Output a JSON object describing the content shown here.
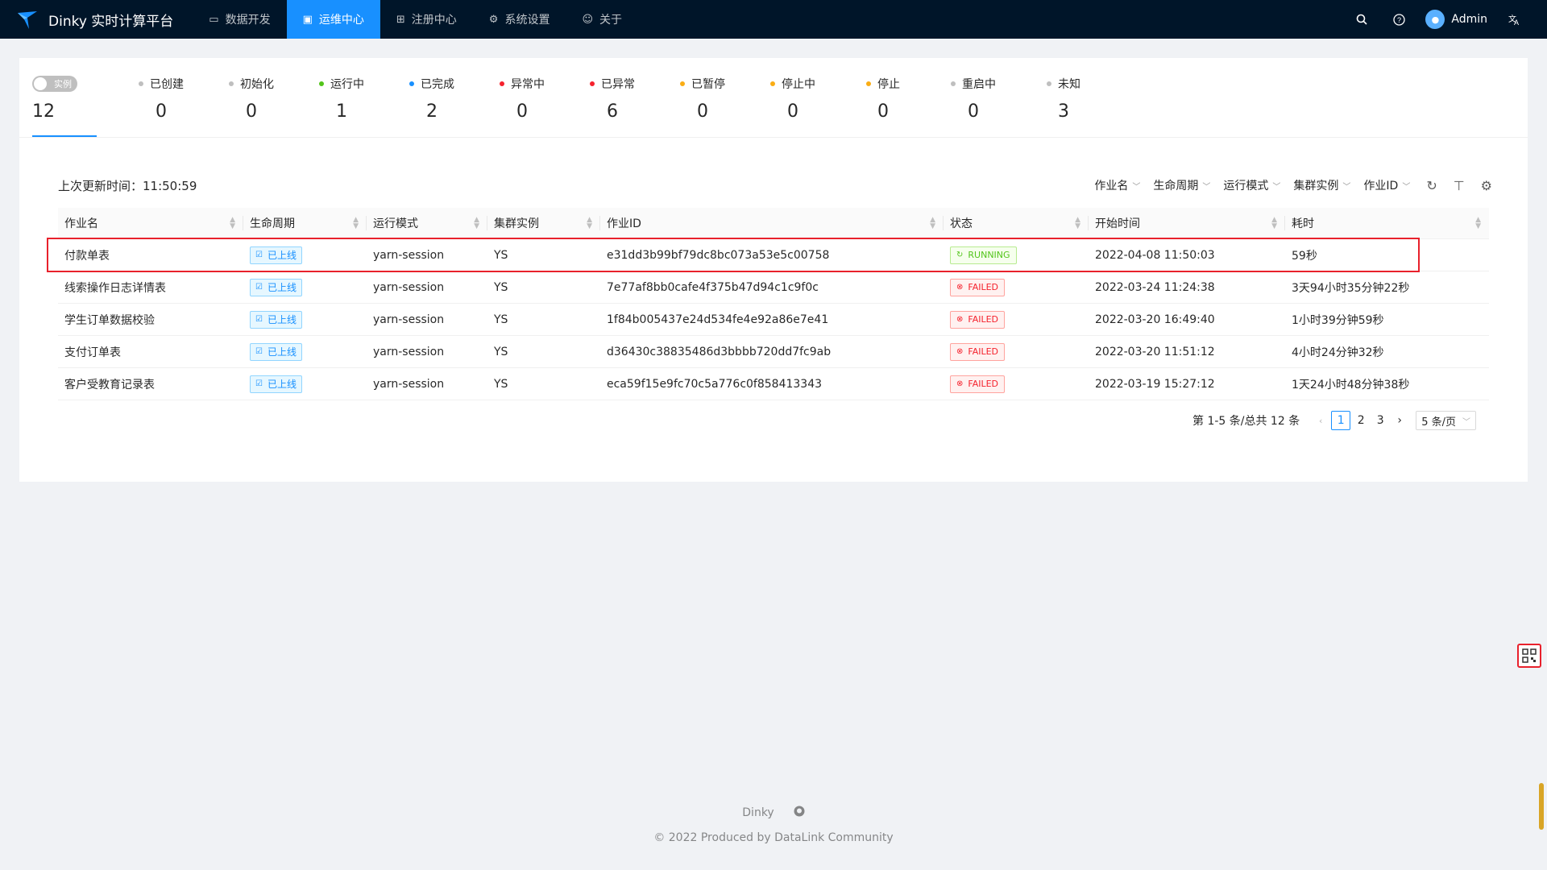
{
  "app": {
    "title": "Dinky 实时计算平台"
  },
  "nav": [
    {
      "label": "数据开发",
      "icon": "monitor-icon"
    },
    {
      "label": "运维中心",
      "icon": "dashboard-icon",
      "active": true
    },
    {
      "label": "注册中心",
      "icon": "appstore-icon"
    },
    {
      "label": "系统设置",
      "icon": "gear-icon"
    },
    {
      "label": "关于",
      "icon": "check-circle-icon"
    }
  ],
  "user": {
    "name": "Admin"
  },
  "stats": {
    "switch_label": "实例",
    "total": "12",
    "items": [
      {
        "label": "已创建",
        "value": "0",
        "color": "#bfbfbf"
      },
      {
        "label": "初始化",
        "value": "0",
        "color": "#bfbfbf"
      },
      {
        "label": "运行中",
        "value": "1",
        "color": "#52c41a"
      },
      {
        "label": "已完成",
        "value": "2",
        "color": "#1890ff"
      },
      {
        "label": "异常中",
        "value": "0",
        "color": "#f5222d"
      },
      {
        "label": "已异常",
        "value": "6",
        "color": "#f5222d"
      },
      {
        "label": "已暂停",
        "value": "0",
        "color": "#faad14"
      },
      {
        "label": "停止中",
        "value": "0",
        "color": "#faad14"
      },
      {
        "label": "停止",
        "value": "0",
        "color": "#faad14"
      },
      {
        "label": "重启中",
        "value": "0",
        "color": "#bfbfbf"
      },
      {
        "label": "未知",
        "value": "3",
        "color": "#bfbfbf"
      }
    ]
  },
  "toolbar": {
    "last_update": "上次更新时间：11:50:59",
    "filters": [
      "作业名",
      "生命周期",
      "运行模式",
      "集群实例",
      "作业ID"
    ]
  },
  "table": {
    "columns": [
      "作业名",
      "生命周期",
      "运行模式",
      "集群实例",
      "作业ID",
      "状态",
      "开始时间",
      "耗时"
    ],
    "rows": [
      {
        "name": "付款单表",
        "lifecycle": "已上线",
        "mode": "yarn-session",
        "cluster": "YS",
        "job_id": "e31dd3b99bf79dc8bc073a53e5c00758",
        "status": "RUNNING",
        "start": "2022-04-08 11:50:03",
        "duration": "59秒"
      },
      {
        "name": "线索操作日志详情表",
        "lifecycle": "已上线",
        "mode": "yarn-session",
        "cluster": "YS",
        "job_id": "7e77af8bb0cafe4f375b47d94c1c9f0c",
        "status": "FAILED",
        "start": "2022-03-24 11:24:38",
        "duration": "3天94小时35分钟22秒"
      },
      {
        "name": "学生订单数据校验",
        "lifecycle": "已上线",
        "mode": "yarn-session",
        "cluster": "YS",
        "job_id": "1f84b005437e24d534fe4e92a86e7e41",
        "status": "FAILED",
        "start": "2022-03-20 16:49:40",
        "duration": "1小时39分钟59秒"
      },
      {
        "name": "支付订单表",
        "lifecycle": "已上线",
        "mode": "yarn-session",
        "cluster": "YS",
        "job_id": "d36430c38835486d3bbbb720dd7fc9ab",
        "status": "FAILED",
        "start": "2022-03-20 11:51:12",
        "duration": "4小时24分钟32秒"
      },
      {
        "name": "客户受教育记录表",
        "lifecycle": "已上线",
        "mode": "yarn-session",
        "cluster": "YS",
        "job_id": "eca59f15e9fc70c5a776c0f858413343",
        "status": "FAILED",
        "start": "2022-03-19 15:27:12",
        "duration": "1天24小时48分钟38秒"
      }
    ]
  },
  "pagination": {
    "summary": "第 1-5 条/总共 12 条",
    "pages": [
      "1",
      "2",
      "3"
    ],
    "current": "1",
    "page_size": "5 条/页"
  },
  "footer": {
    "brand": "Dinky",
    "copyright": "© 2022 Produced by DataLink Community"
  }
}
